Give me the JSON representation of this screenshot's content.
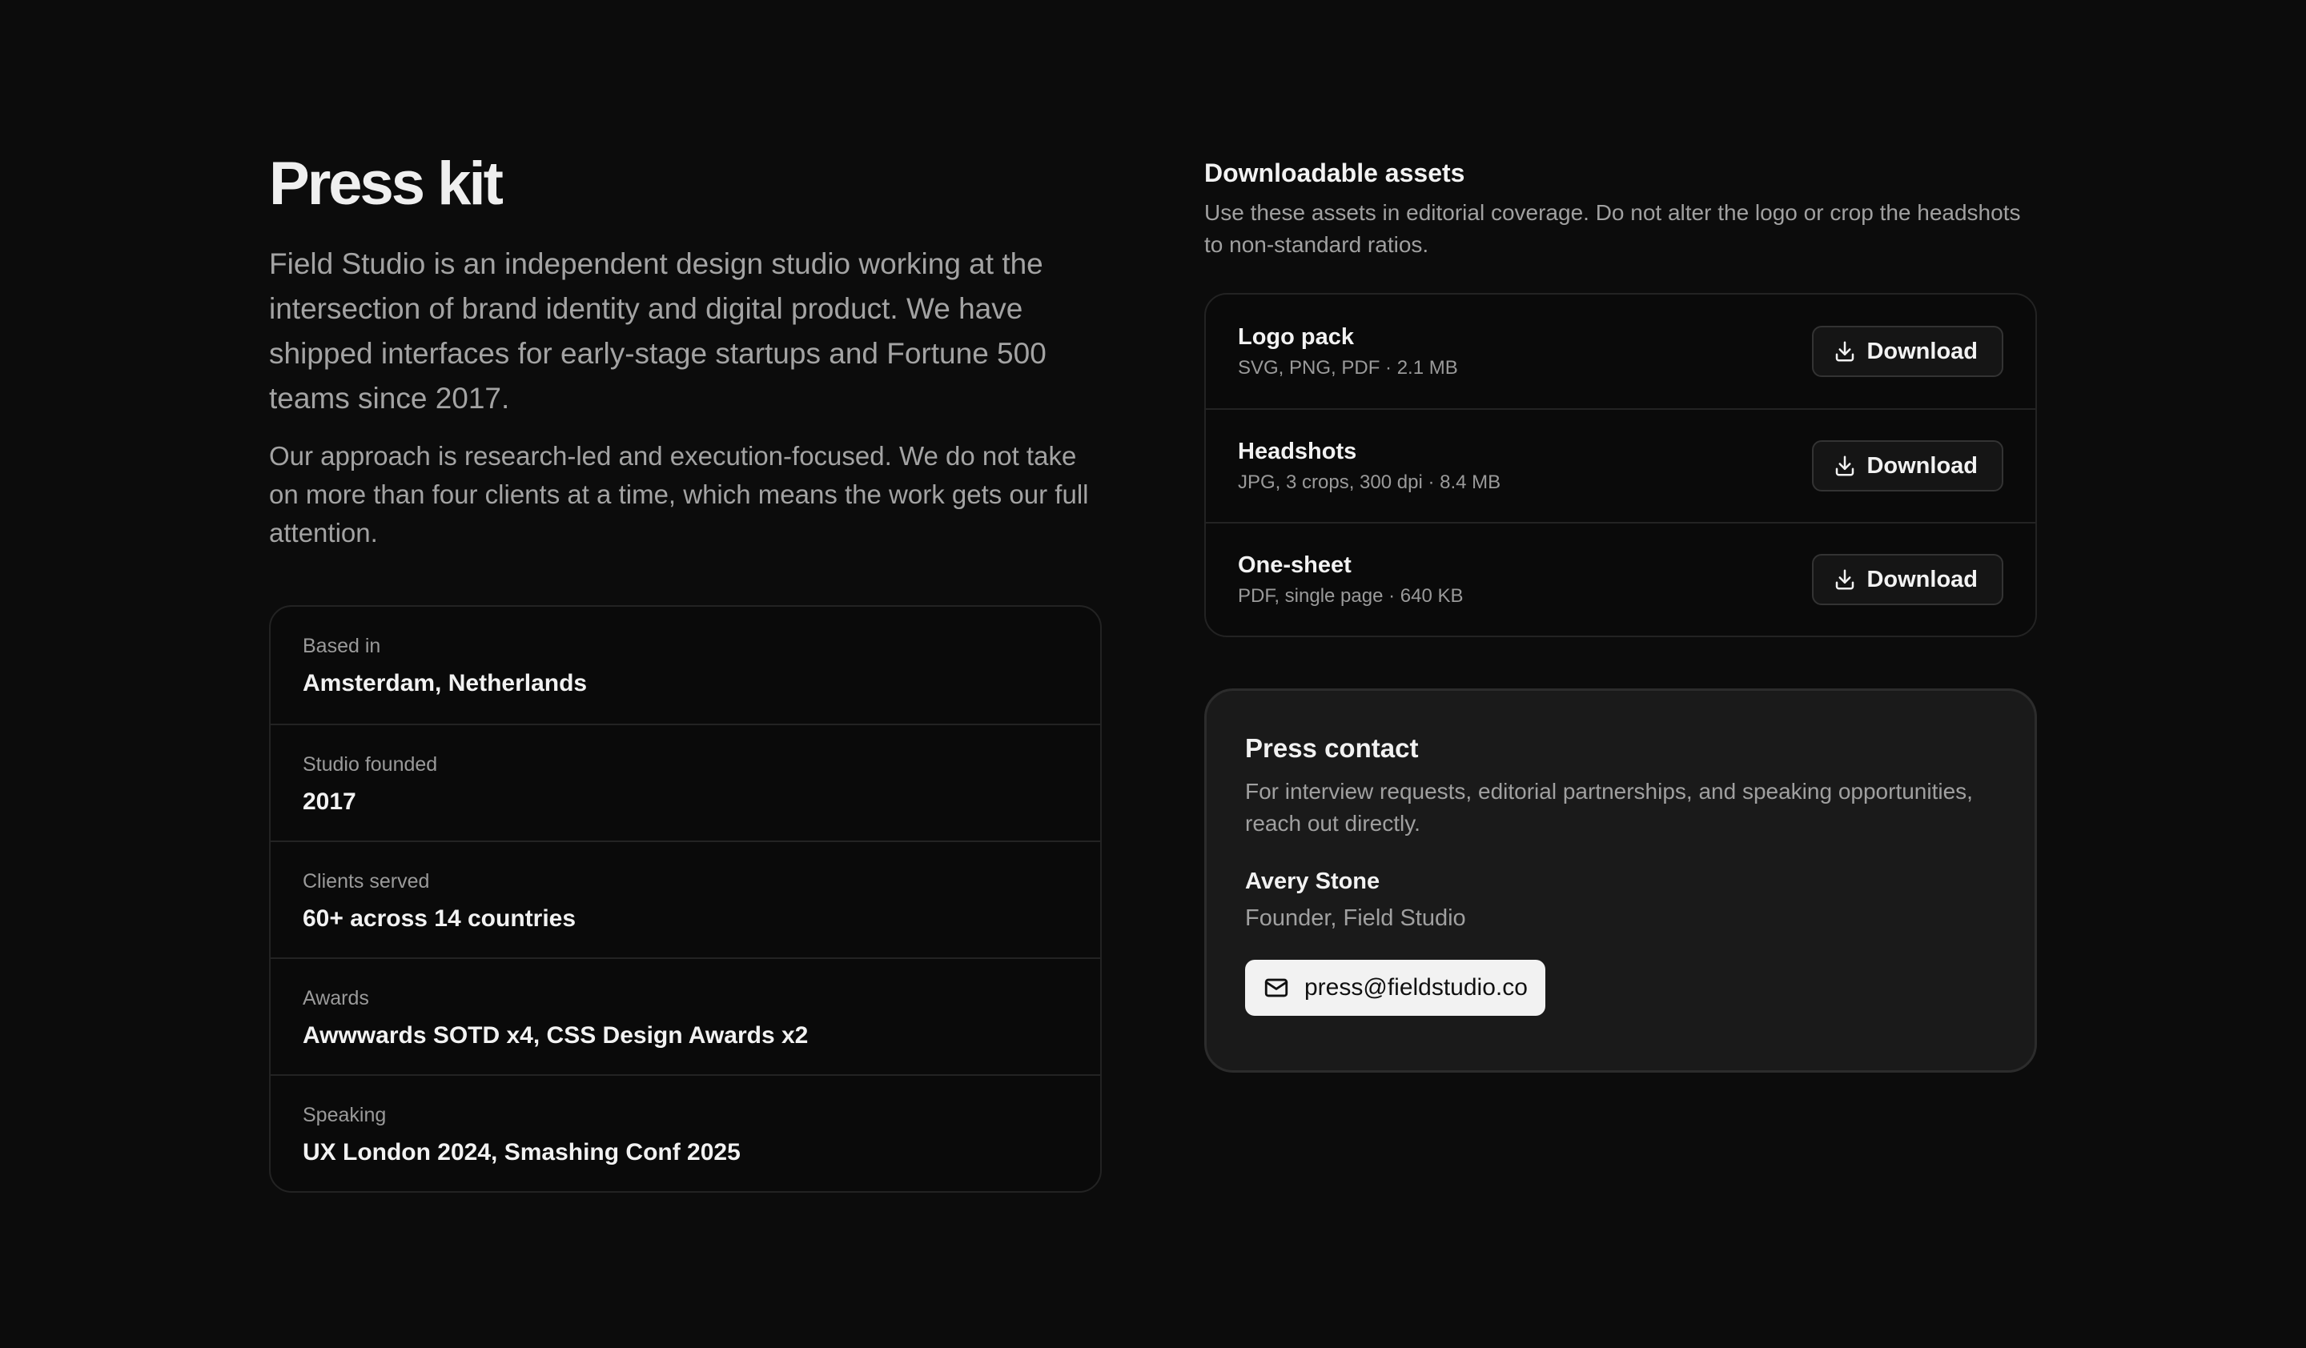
{
  "intro": {
    "title": "Press kit",
    "lede": "Field Studio is an independent design studio working at the intersection of brand identity and digital product. We have shipped interfaces for early-stage startups and Fortune 500 teams since 2017.",
    "approach": "Our approach is research-led and execution-focused. We do not take on more than four clients at a time, which means the work gets our full attention."
  },
  "facts": [
    {
      "label": "Based in",
      "value": "Amsterdam, Netherlands"
    },
    {
      "label": "Studio founded",
      "value": "2017"
    },
    {
      "label": "Clients served",
      "value": "60+ across 14 countries"
    },
    {
      "label": "Awards",
      "value": "Awwwards SOTD x4, CSS Design Awards x2"
    },
    {
      "label": "Speaking",
      "value": "UX London 2024, Smashing Conf 2025"
    }
  ],
  "assets": {
    "title": "Downloadable assets",
    "description": "Use these assets in editorial coverage. Do not alter the logo or crop the headshots to non-standard ratios.",
    "items": [
      {
        "name": "Logo pack",
        "meta": "SVG, PNG, PDF · 2.1 MB",
        "button_label": "Download",
        "icon": "download-icon"
      },
      {
        "name": "Headshots",
        "meta": "JPG, 3 crops, 300 dpi · 8.4 MB",
        "button_label": "Download",
        "icon": "download-icon"
      },
      {
        "name": "One-sheet",
        "meta": "PDF, single page · 640 KB",
        "button_label": "Download",
        "icon": "download-icon"
      }
    ]
  },
  "contact": {
    "title": "Press contact",
    "description": "For interview requests, editorial partnerships, and speaking opportunities, reach out directly.",
    "name": "Avery Stone",
    "role": "Founder, Field Studio",
    "email": "press@fieldstudio.co",
    "email_icon": "mail-icon"
  },
  "colors": {
    "background": "#0c0c0c",
    "card_border": "#232323",
    "contact_card_bg": "#1a1a1a",
    "text_primary": "#f2f2f2",
    "text_muted": "#a0a0a0",
    "email_button_bg": "#f2f2f2"
  }
}
